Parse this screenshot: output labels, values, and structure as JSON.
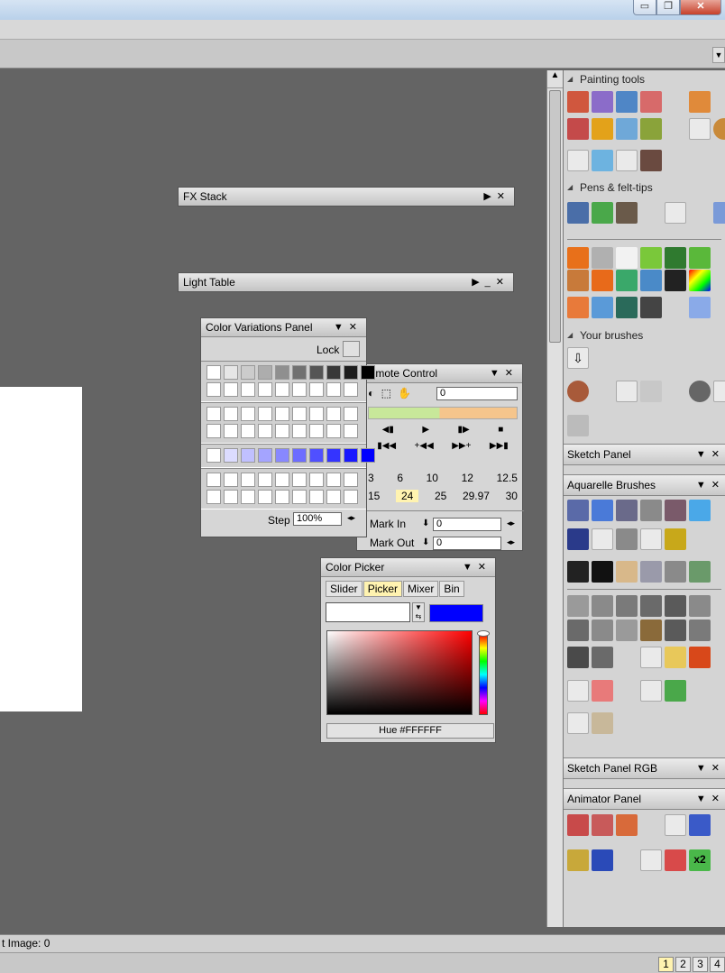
{
  "window": {
    "min_glyph": "▭",
    "max_glyph": "❐",
    "close_glyph": "✕"
  },
  "fx_stack": {
    "title": "FX Stack"
  },
  "light_table": {
    "title": "Light Table"
  },
  "color_variations": {
    "title": "Color Variations Panel",
    "lock_label": "Lock",
    "step_label": "Step",
    "step_value": "100%",
    "gray_row": [
      "#ffffff",
      "#e6e6e6",
      "#cccccc",
      "#adadad",
      "#8f8f8f",
      "#717171",
      "#555555",
      "#393939",
      "#1d1d1d",
      "#000000"
    ],
    "blue_row": [
      "#ffffff",
      "#dcdcff",
      "#c0c0ff",
      "#a4a4ff",
      "#8888ff",
      "#6c6cff",
      "#5050ff",
      "#3434ff",
      "#1818ff",
      "#0000ff"
    ]
  },
  "remote_control": {
    "title": "Remote Control",
    "frame_value": "0",
    "fps_row1": [
      "3",
      "6",
      "10",
      "12",
      "12.5"
    ],
    "fps_row2": [
      "15",
      "24",
      "25",
      "29.97",
      "30"
    ],
    "fps_selected": "24",
    "mark_in_label": "Mark In",
    "mark_in_value": "0",
    "mark_out_label": "Mark Out",
    "mark_out_value": "0"
  },
  "color_picker": {
    "title": "Color Picker",
    "tabs": [
      "Slider",
      "Picker",
      "Mixer",
      "Bin"
    ],
    "active_tab": "Picker",
    "current_color": "#0000ff",
    "hue_label": "Hue #FFFFFF"
  },
  "right_panel": {
    "painting_tools": "Painting tools",
    "pens": "Pens & felt-tips",
    "your_brushes": "Your brushes",
    "sketch_panel": "Sketch Panel",
    "aquarelle": "Aquarelle Brushes",
    "sketch_rgb": "Sketch Panel RGB",
    "animator": "Animator Panel",
    "x2_label": "x2"
  },
  "status": {
    "text": "t Image: 0"
  },
  "pages": [
    "1",
    "2",
    "3",
    "4"
  ],
  "active_page": "1"
}
